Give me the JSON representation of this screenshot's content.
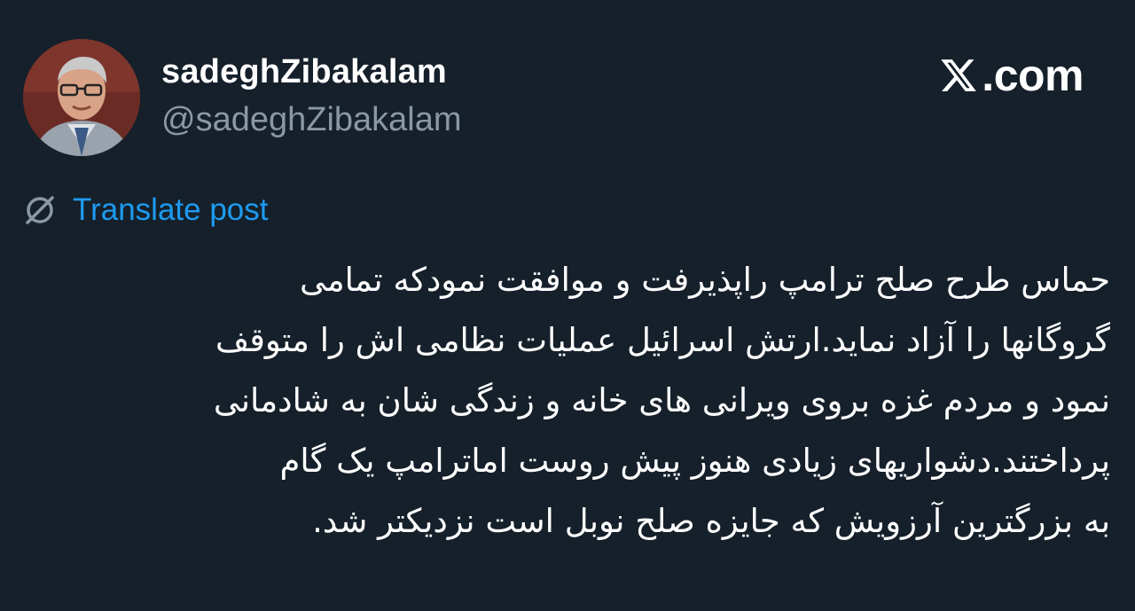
{
  "author": {
    "display_name": "sadeghZibakalam",
    "handle": "@sadeghZibakalam",
    "avatar_icon": "profile-photo"
  },
  "brand": {
    "logo_icon": "x-logo-icon",
    "domain": ".com"
  },
  "translate": {
    "icon": "globe-icon",
    "label": "Translate post",
    "color": "#1d9bf0"
  },
  "post": {
    "lines": [
      "حماس طرح صلح ترامپ راپذیرفت و موافقت نمودکه تمامی",
      "گروگانها را آزاد نماید.ارتش اسرائیل عملیات نظامی اش را متوقف",
      "نمود و مردم غزه بروی ویرانی های خانه و زندگی شان به شادمانی",
      "پرداختند.دشواریهای زیادی هنوز پیش روست اماترامپ یک گام",
      "به بزرگترین آرزویش که جایزه صلح نوبل است نزدیکتر شد."
    ]
  },
  "colors": {
    "background": "#15202b",
    "text": "#ffffff",
    "secondary": "#8b98a5"
  }
}
